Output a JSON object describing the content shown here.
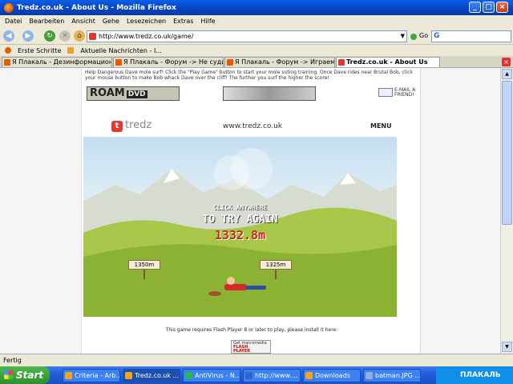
{
  "window": {
    "title": "Tredz.co.uk - About Us - Mozilla Firefox"
  },
  "menu": {
    "items": [
      "Datei",
      "Bearbeiten",
      "Ansicht",
      "Gehe",
      "Lesezeichen",
      "Extras",
      "Hilfe"
    ]
  },
  "nav": {
    "url": "http://www.tredz.co.uk/game/",
    "go_label": "Go"
  },
  "bookmarks": {
    "items": [
      "Erste Schritte",
      "Aktuelle Nachrichten - I..."
    ]
  },
  "tabs": [
    {
      "label": "Я Плакаль - Дезинформационны..."
    },
    {
      "label": "Я Плакаль - Форум -> Не судит..."
    },
    {
      "label": "Я Плакаль - Форум -> Играем!!! ..."
    },
    {
      "label": "Tredz.co.uk - About Us"
    }
  ],
  "page": {
    "intro": "Help Dangerous Dave mole surf! Click the \"Play Game\" button to start your mole suting training. Once Dave rides near Brutal Bob, click your mouse button to make Bob whack Dave over the cliff! The further you surf the higher the score!",
    "banner_roam": "ROAM",
    "banner_dvd": "DVD",
    "email_line1": "E-MAIL A",
    "email_line2": "FRIEND!",
    "brand": "tredz",
    "site": "www.tredz.co.uk",
    "menu": "MENU",
    "footer": "This game requires Flash Player 8 or later to play, please install it here:",
    "flash_badge_1": "Get macromedia",
    "flash_badge_2": "FLASH",
    "flash_badge_3": "PLAYER"
  },
  "game": {
    "line1": "CLICK ANYWHERE",
    "line2": "TO TRY AGAIN",
    "score": "1332.8m",
    "sign1": "1350m",
    "sign2": "1325m"
  },
  "status": {
    "text": "Fertig"
  },
  "taskbar": {
    "start": "Start",
    "items": [
      "Criteria - Arb...",
      "Tredz.co.uk ...",
      "AntiVirus - N...",
      "http://www....",
      "Downloads",
      "batman.JPG ..."
    ],
    "tray_text": "ПЛАКАЛЬ"
  }
}
